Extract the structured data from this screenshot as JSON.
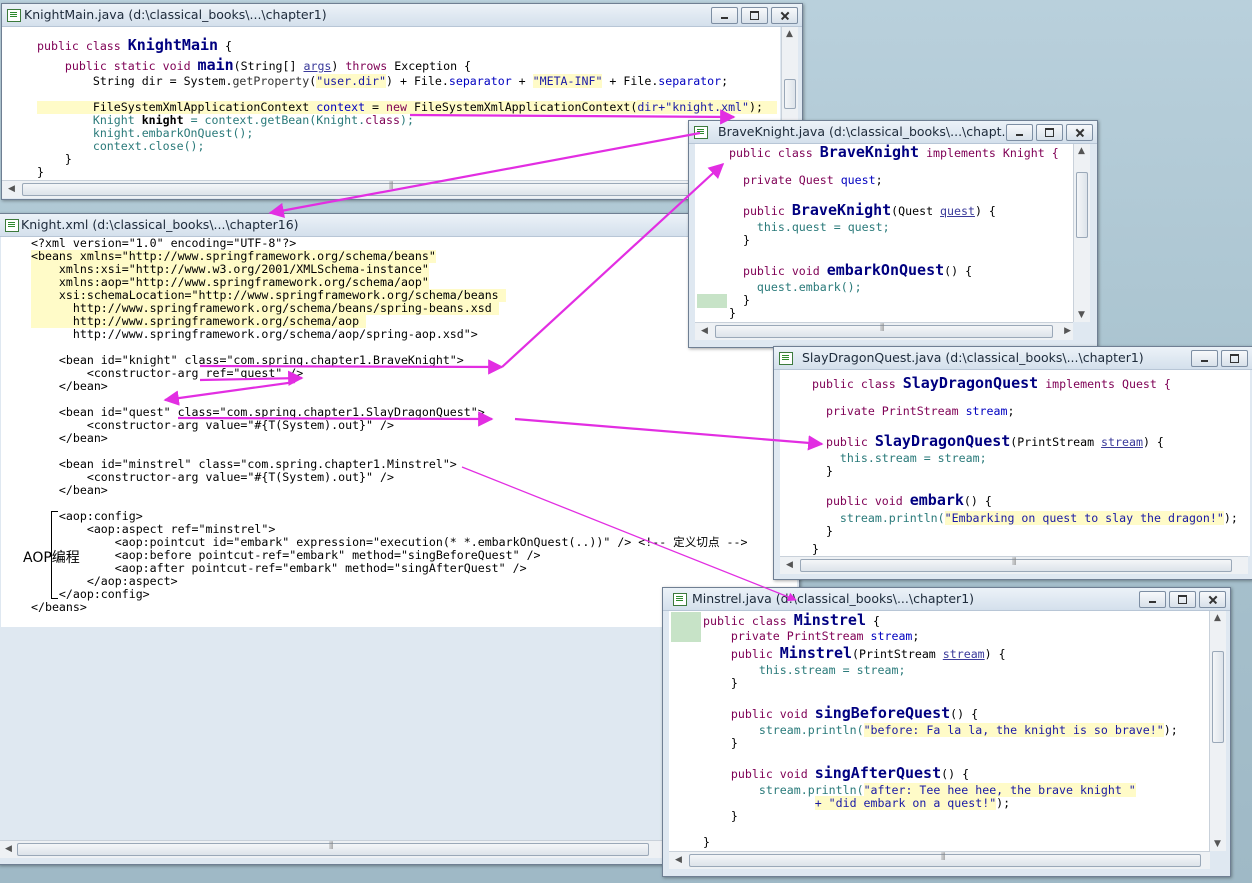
{
  "windows": {
    "knightmain": {
      "title": "KnightMain.java (d:\\classical_books\\...\\chapter1)"
    },
    "knightxml": {
      "title": "Knight.xml (d:\\classical_books\\...\\chapter16)"
    },
    "braveknight": {
      "title": "BraveKnight.java (d:\\classical_books\\...\\chapt..."
    },
    "slaydragon": {
      "title": "SlayDragonQuest.java (d:\\classical_books\\...\\chapter1)"
    },
    "minstrel": {
      "title": "Minstrel.java (d:\\classical_books\\...\\chapter1)"
    }
  },
  "knightmain_code": {
    "l1a": "public class ",
    "l1b": "KnightMain",
    "l1c": " {",
    "l2a": "    public static void ",
    "l2b": "main",
    "l2c": "(String[] ",
    "l2d": "args",
    "l2e": ") ",
    "l2f": "throws",
    "l2g": " Exception {",
    "l3a": "        String dir = System.",
    "l3b": "getProperty",
    "l3c": "(",
    "l3d": "\"user.dir\"",
    "l3e": ") + File.",
    "l3f": "separator",
    "l3g": " + ",
    "l3h": "\"META-INF\"",
    "l3i": " + File.",
    "l3j": "separator",
    "l3k": ";",
    "l4a": "        FileSystemXmlApplicationContext ",
    "l4b": "context",
    "l4c": " = ",
    "l4d": "new",
    "l4e": " FileSystemXmlApplicationContext(",
    "l4f": "dir+\"knight.xml\"",
    "l4g": ");",
    "l5a": "        Knight ",
    "l5b": "knight",
    "l5c": " = context.getBean(Knight.",
    "l5d": "class",
    "l5e": ");",
    "l6": "        knight.embarkOnQuest();",
    "l7": "        context.close();",
    "l8": "    }",
    "l9": "}"
  },
  "knightxml_code": {
    "x1": "<?xml version=\"1.0\" encoding=\"UTF-8\"?>",
    "x2": "<beans xmlns=\"http://www.springframework.org/schema/beans\"",
    "x3": "    xmlns:xsi=\"http://www.w3.org/2001/XMLSchema-instance\"",
    "x4": "    xmlns:aop=\"http://www.springframework.org/schema/aop\"",
    "x5": "    xsi:schemaLocation=\"http://www.springframework.org/schema/beans ",
    "x6": "      http://www.springframework.org/schema/beans/spring-beans.xsd ",
    "x7": "      http://www.springframework.org/schema/aop ",
    "x8": "      http://www.springframework.org/schema/aop/spring-aop.xsd\">",
    "x9": "    <bean id=\"knight\" class=\"com.spring.chapter1.BraveKnight\">",
    "x10": "        <constructor-arg ref=\"quest\" />",
    "x11": "    </bean>",
    "x12": "    <bean id=\"quest\" class=\"com.spring.chapter1.SlayDragonQuest\">",
    "x13": "        <constructor-arg value=\"#{T(System).out}\" />",
    "x14": "    </bean>",
    "x15": "    <bean id=\"minstrel\" class=\"com.spring.chapter1.Minstrel\">",
    "x16": "        <constructor-arg value=\"#{T(System).out}\" />",
    "x17": "    </bean>",
    "x18": "    <aop:config>",
    "x19": "        <aop:aspect ref=\"minstrel\">",
    "x20": "            <aop:pointcut id=\"embark\" expression=\"execution(* *.embarkOnQuest(..))\" /> <!-- 定义切点 -->",
    "x21": "            <aop:before pointcut-ref=\"embark\" method=\"singBeforeQuest\" />",
    "x22": "            <aop:after pointcut-ref=\"embark\" method=\"singAfterQuest\" />",
    "x23": "        </aop:aspect>",
    "x24": "    </aop:config>",
    "x25": "</beans>",
    "aop_label": "AOP编程"
  },
  "braveknight_code": {
    "b1a": "public class ",
    "b1b": "BraveKnight",
    "b1c": " implements Knight {",
    "b2a": "  private Quest ",
    "b2b": "quest",
    "b2c": ";",
    "b3a": "  public ",
    "b3b": "BraveKnight",
    "b3c": "(Quest ",
    "b3d": "quest",
    "b3e": ") {",
    "b4a": "    this.",
    "b4b": "quest",
    "b4c": " = ",
    "b4d": "quest",
    "b4e": ";",
    "b5": "  }",
    "b6a": "  public void ",
    "b6b": "embarkOnQuest",
    "b6c": "() {",
    "b7a": "    ",
    "b7b": "quest",
    "b7c": ".embark();",
    "b8": "  }",
    "b9": "}"
  },
  "slaydragon_code": {
    "s1a": "public class ",
    "s1b": "SlayDragonQuest",
    "s1c": " implements Quest {",
    "s2a": "  private PrintStream ",
    "s2b": "stream",
    "s2c": ";",
    "s3a": "  public ",
    "s3b": "SlayDragonQuest",
    "s3c": "(PrintStream ",
    "s3d": "stream",
    "s3e": ") {",
    "s4a": "    this.",
    "s4b": "stream",
    "s4c": " = ",
    "s4d": "stream",
    "s4e": ";",
    "s5": "  }",
    "s6a": "  public void ",
    "s6b": "embark",
    "s6c": "() {",
    "s7a": "    ",
    "s7b": "stream",
    "s7c": ".println(",
    "s7d": "\"Embarking on quest to slay the dragon!\"",
    "s7e": ");",
    "s8": "  }",
    "s9": "}"
  },
  "minstrel_code": {
    "m1a": "public class ",
    "m1b": "Minstrel",
    "m1c": " {",
    "m2a": "    private PrintStream ",
    "m2b": "stream",
    "m2c": ";",
    "m3a": "    public ",
    "m3b": "Minstrel",
    "m3c": "(PrintStream ",
    "m3d": "stream",
    "m3e": ") {",
    "m4a": "        this.",
    "m4b": "stream",
    "m4c": " = ",
    "m4d": "stream",
    "m4e": ";",
    "m5": "    }",
    "m6a": "    public void ",
    "m6b": "singBeforeQuest",
    "m6c": "() {",
    "m7a": "        ",
    "m7b": "stream",
    "m7c": ".println(",
    "m7d": "\"before: Fa la la, the knight is so brave!\"",
    "m7e": ");",
    "m8": "    }",
    "m9a": "    public void ",
    "m9b": "singAfterQuest",
    "m9c": "() {",
    "m10a": "        ",
    "m10b": "stream",
    "m10c": ".println(",
    "m10d": "\"after: Tee hee hee, the brave knight \"",
    "m10e": "",
    "m11a": "                ",
    "m11b": "+ \"did embark on a quest!\"",
    "m11c": ");",
    "m12": "    }",
    "m13": "}"
  },
  "colors": {
    "arrow": "#e22ee2",
    "desktop": "#a9c3cf",
    "title_bg": "#dfe8f1"
  },
  "icons": {
    "file": "java-file-icon",
    "minimize": "minimize-icon",
    "maximize": "maximize-icon",
    "close": "close-icon"
  }
}
